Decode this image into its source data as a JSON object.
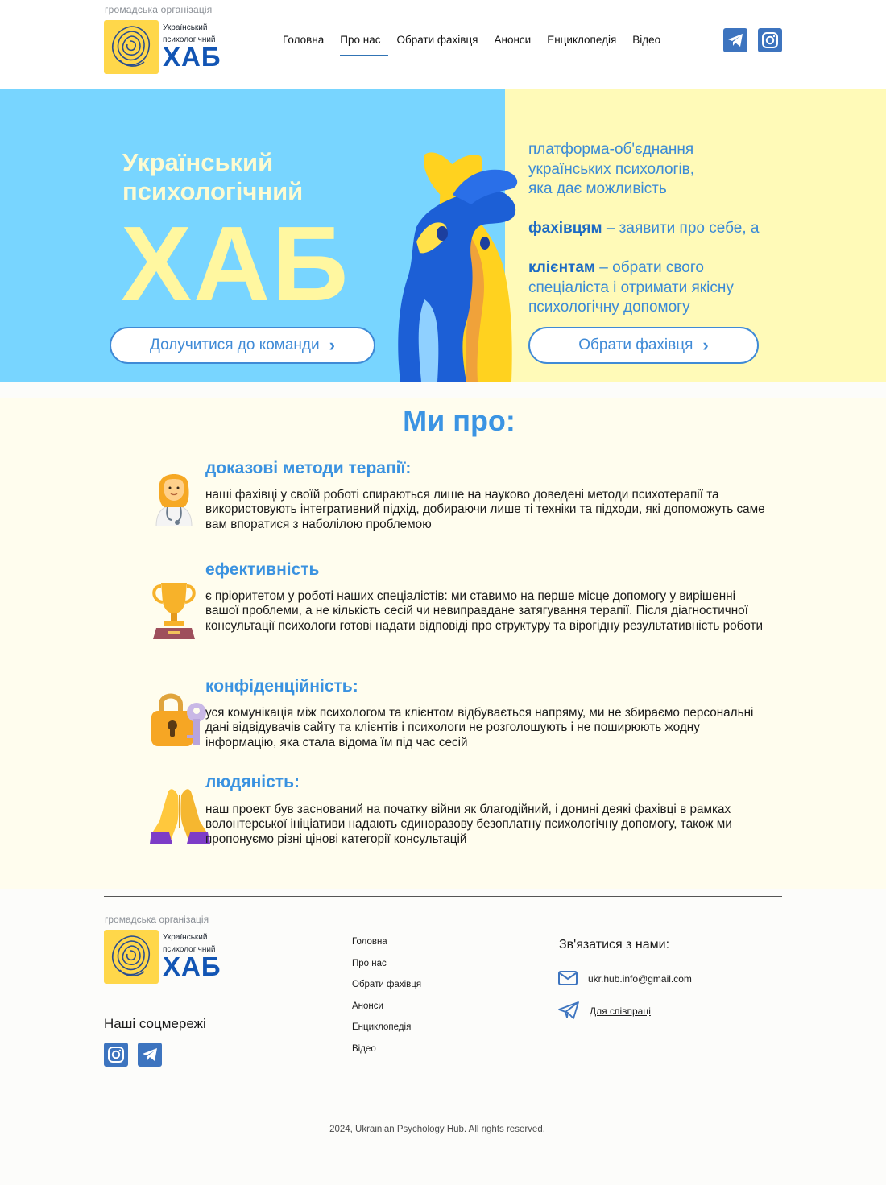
{
  "header": {
    "org_label": "громадська організація",
    "logo_line1": "Український",
    "logo_line2": "психологічний",
    "logo_big": "ХАБ",
    "nav": [
      {
        "label": "Головна",
        "active": false
      },
      {
        "label": "Про нас",
        "active": true
      },
      {
        "label": "Обрати фахівця",
        "active": false
      },
      {
        "label": "Анонси",
        "active": false
      },
      {
        "label": "Енциклопедія",
        "active": false
      },
      {
        "label": "Відео",
        "active": false
      }
    ],
    "social_icons": [
      "telegram-icon",
      "instagram-icon"
    ]
  },
  "hero": {
    "subtitle_line1": "Український",
    "subtitle_line2": "психологічний",
    "big_title": "ХАБ",
    "join_button": "Долучитися до команди",
    "desc_line1": "платформа-об'єднання",
    "desc_line2": "українських психологів,",
    "desc_line3": "яка дає можливість",
    "specialists_bold": "фахівцям",
    "specialists_text": " – заявити про себе, а",
    "clients_bold": "клієнтам",
    "clients_text": " – обрати свого спеціаліста і отримати якісну психологічну допомогу",
    "choose_button": "Обрати фахівця",
    "colors": {
      "left_bg": "#78d5ff",
      "right_bg": "#fffab8",
      "accent": "#3f8ad6"
    }
  },
  "about": {
    "title": "Ми про:",
    "features": [
      {
        "icon": "woman-doctor-icon",
        "title": "доказові методи терапії:",
        "text": "наші фахівці у своїй роботі спираються лише на науково доведені методи психотерапії та використовують інтегративний підхід, добираючи лише ті техніки та підходи, які допоможуть саме вам впоратися з наболілою проблемою"
      },
      {
        "icon": "trophy-icon",
        "title": "ефективність",
        "text": "є пріоритетом у роботі наших спеціалістів: ми ставимо на перше місце допомогу у вирішенні вашої проблеми, а не кількість сесій чи невиправдане затягування терапії. Після діагностичної консультації психологи готові надати відповіді про структуру та вірогідну результативність роботи"
      },
      {
        "icon": "lock-with-key-icon",
        "title": "конфіденційність:",
        "text": "уся комунікація між психологом та клієнтом відбувається напряму, ми не збираємо персональні дані відвідувачів сайту та клієнтів і психологи не розголошують і не поширюють жодну інформацію, яка стала відома їм під час сесій"
      },
      {
        "icon": "folded-hands-icon",
        "title": "людяність:",
        "text": "наш проект був заснований на початку війни як благодійний, і донині деякі фахівці в рамках волонтерської ініціативи надають єдиноразову безоплатну психологічну допомогу, також ми пропонуємо різні цінові категорії консультацій"
      }
    ]
  },
  "footer": {
    "org_label": "громадська організація",
    "logo_line1": "Український",
    "logo_line2": "психологічний",
    "logo_big": "ХАБ",
    "social_title": "Наші соцмережі",
    "nav": [
      "Головна",
      "Про нас",
      "Обрати фахівця",
      "Анонси",
      "Енциклопедія",
      "Відео"
    ],
    "contact_title": "Зв'язатися з нами:",
    "email": "ukr.hub.info@gmail.com",
    "cooperation": "Для співпраці",
    "copyright": "2024, Ukrainian Psychology Hub. All rights reserved."
  }
}
